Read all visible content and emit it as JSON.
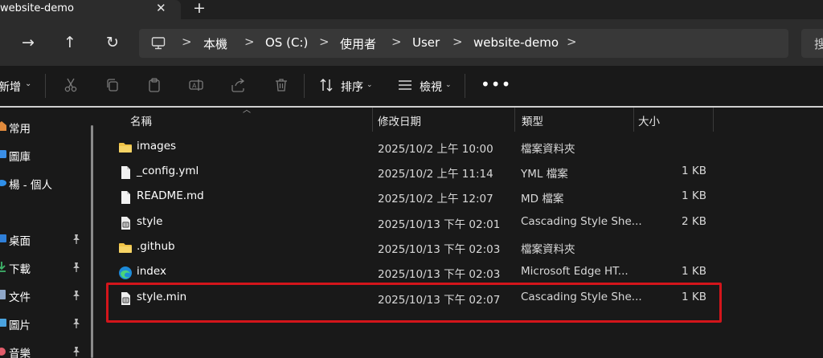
{
  "tab": {
    "title": "website-demo",
    "close": "✕",
    "new_tab": "+"
  },
  "nav": {
    "forward": "→",
    "up": "↑",
    "refresh": "↻",
    "breadcrumb": [
      "本機",
      "OS (C:)",
      "使用者",
      "User",
      "website-demo"
    ],
    "separator": ">",
    "search_text": "搜"
  },
  "commands": {
    "new_label": "新增",
    "sort_label": "排序",
    "view_label": "檢視",
    "more": "•••",
    "icons": [
      "cut-icon",
      "copy-icon",
      "paste-icon",
      "rename-icon",
      "share-icon",
      "delete-icon"
    ]
  },
  "sidebar": {
    "items": [
      {
        "label": "常用",
        "icon": "home-icon",
        "pinned": false
      },
      {
        "label": "圖庫",
        "icon": "gallery-icon",
        "pinned": false
      },
      {
        "label": "楊 - 個人",
        "icon": "onedrive-icon",
        "pinned": false
      },
      {
        "label": "桌面",
        "icon": "desktop-icon",
        "pinned": true
      },
      {
        "label": "下載",
        "icon": "download-icon",
        "pinned": true
      },
      {
        "label": "文件",
        "icon": "documents-icon",
        "pinned": true
      },
      {
        "label": "圖片",
        "icon": "pictures-icon",
        "pinned": true
      },
      {
        "label": "音樂",
        "icon": "music-icon",
        "pinned": true
      }
    ]
  },
  "columns": {
    "name": "名稱",
    "date": "修改日期",
    "type": "類型",
    "size": "大小"
  },
  "files": [
    {
      "name": "images",
      "date": "2025/10/2 上午 10:00",
      "type": "檔案資料夾",
      "size": "",
      "icon": "folder-icon"
    },
    {
      "name": "_config.yml",
      "date": "2025/10/2 上午 11:14",
      "type": "YML 檔案",
      "size": "1 KB",
      "icon": "file-icon"
    },
    {
      "name": "README.md",
      "date": "2025/10/2 上午 12:07",
      "type": "MD 檔案",
      "size": "1 KB",
      "icon": "file-icon"
    },
    {
      "name": "style",
      "date": "2025/10/13 下午 02:01",
      "type": "Cascading Style She...",
      "size": "2 KB",
      "icon": "css-file-icon"
    },
    {
      "name": ".github",
      "date": "2025/10/13 下午 02:03",
      "type": "檔案資料夾",
      "size": "",
      "icon": "folder-icon"
    },
    {
      "name": "index",
      "date": "2025/10/13 下午 02:03",
      "type": "Microsoft Edge HT...",
      "size": "1 KB",
      "icon": "edge-icon"
    },
    {
      "name": "style.min",
      "date": "2025/10/13 下午 02:07",
      "type": "Cascading Style She...",
      "size": "1 KB",
      "icon": "css-file-icon"
    }
  ],
  "colors": {
    "highlight": "#d3151b",
    "folder": "#f0c347",
    "accent": "#60cdff"
  }
}
